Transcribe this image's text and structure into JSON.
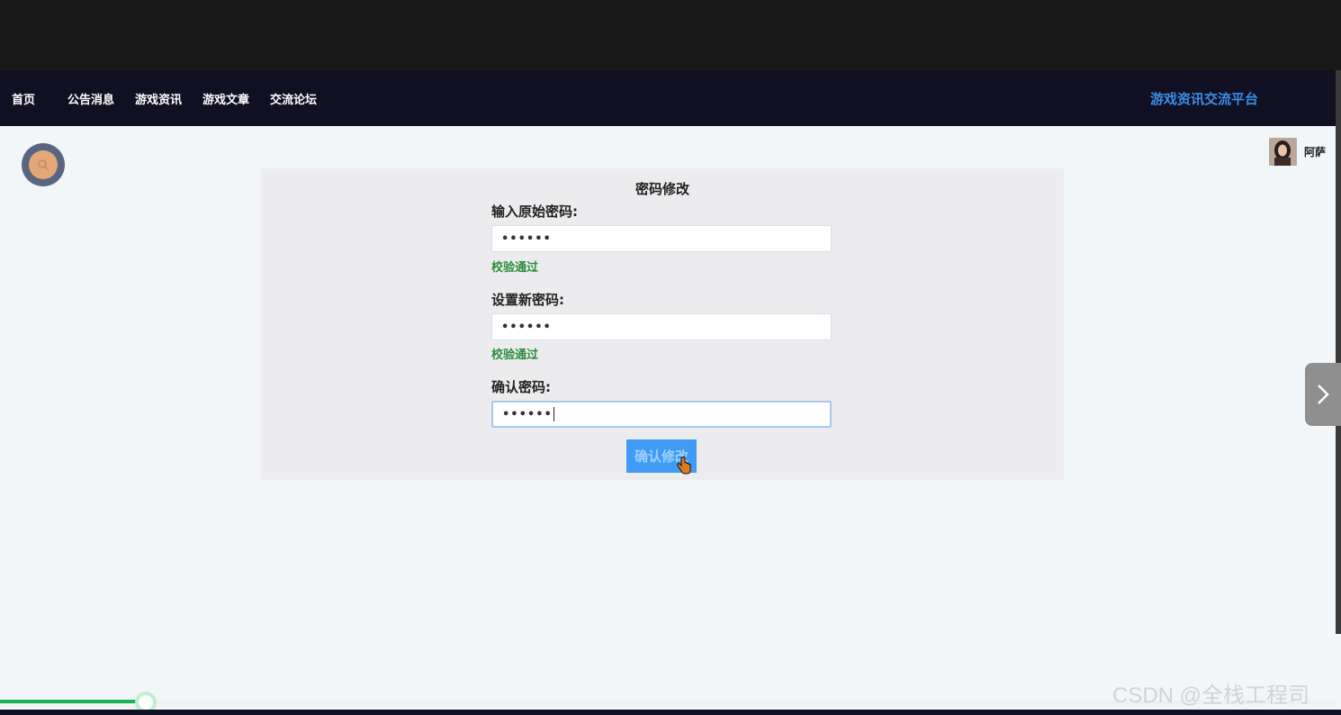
{
  "nav": {
    "items": [
      {
        "label": "首页"
      },
      {
        "label": "公告消息"
      },
      {
        "label": "游戏资讯"
      },
      {
        "label": "游戏文章"
      },
      {
        "label": "交流论坛"
      }
    ],
    "brand": "游戏资讯交流平台"
  },
  "user": {
    "name": "阿萨"
  },
  "form": {
    "title": "密码修改",
    "fields": [
      {
        "label": "输入原始密码:",
        "value": "••••••",
        "validation": "校验通过"
      },
      {
        "label": "设置新密码:",
        "value": "••••••",
        "validation": "校验通过"
      },
      {
        "label": "确认密码:",
        "value": "••••••",
        "validation": ""
      }
    ],
    "submit_label": "确认修改"
  },
  "progress": {
    "fraction": 0.109
  },
  "watermark": "CSDN @全栈工程司",
  "colors": {
    "navbar_bg": "#101022",
    "brand": "#3a8ee6",
    "valid": "#2e8b3d",
    "button": "#3f9bf5",
    "progress": "#14b550"
  },
  "icons": {
    "search": "search-icon",
    "next": "chevron-right-icon",
    "cursor": "hand-pointer-icon"
  }
}
